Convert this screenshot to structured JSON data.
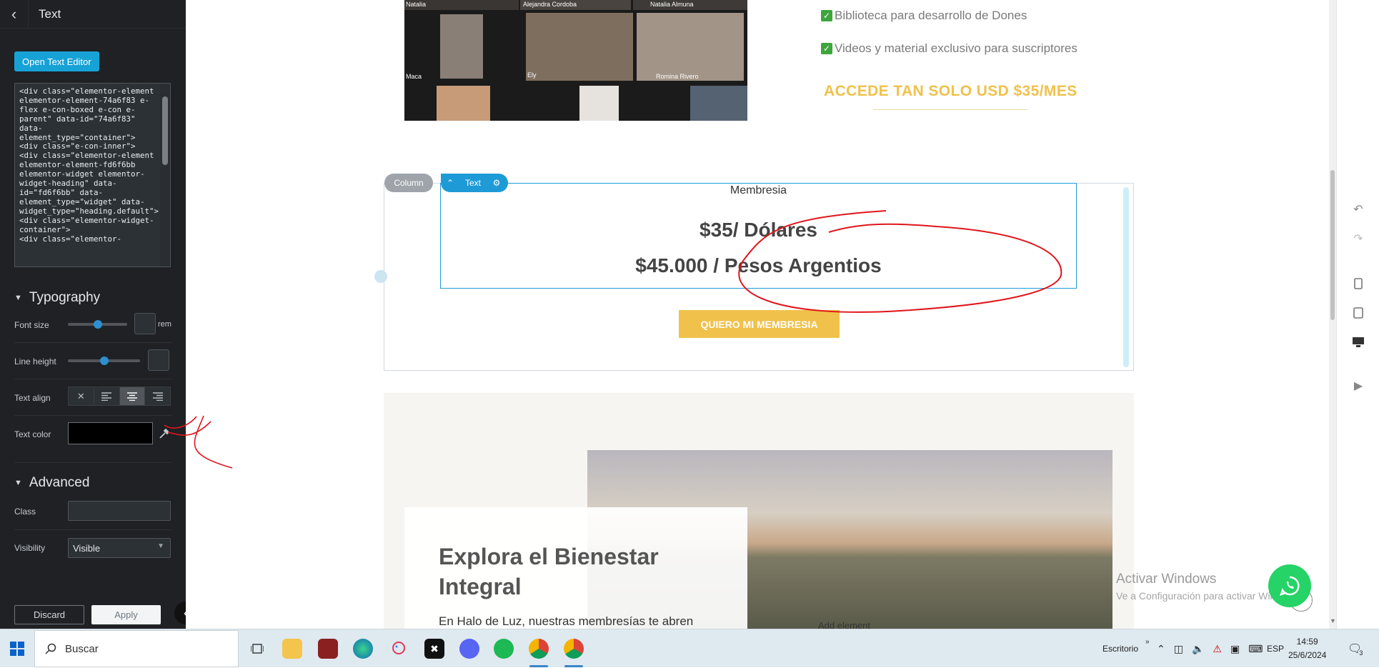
{
  "panel": {
    "title": "Text",
    "open_editor_label": "Open Text Editor",
    "code": "<div class=\"elementor-element elementor-element-74a6f83 e-flex e-con-boxed e-con e-parent\" data-id=\"74a6f83\" data-element_type=\"container\">\n<div class=\"e-con-inner\">\n<div class=\"elementor-element elementor-element-fd6f6bb elementor-widget elementor-widget-heading\" data-id=\"fd6f6bb\" data-element_type=\"widget\" data-widget_type=\"heading.default\">\n<div class=\"elementor-widget-container\">\n<div class=\"elementor-",
    "typography": {
      "title": "Typography",
      "font_size_label": "Font size",
      "font_size_unit": "rem",
      "font_size_level": 0.5,
      "line_height_label": "Line height",
      "line_height_level": 0.5,
      "text_align_label": "Text align",
      "text_align_options": [
        "none",
        "left",
        "center",
        "right"
      ],
      "text_align_selected": "center",
      "text_color_label": "Text color",
      "text_color_value": "#000000"
    },
    "advanced": {
      "title": "Advanced",
      "class_label": "Class",
      "class_value": "",
      "visibility_label": "Visibility",
      "visibility_value": "Visible"
    },
    "discard_label": "Discard",
    "apply_label": "Apply"
  },
  "canvas": {
    "video_names": [
      "Natalia",
      "Alejandra Cordoba",
      "Natalia Almuna",
      "Maca",
      "Ely",
      "Romina Rivero"
    ],
    "benefits": [
      "Biblioteca para desarrollo de Dones",
      "Videos y material exclusivo para suscriptores"
    ],
    "accede": "ACCEDE TAN SOLO USD $35/MES",
    "column_tag": "Column",
    "text_tag": "Text",
    "membresia": "Membresia",
    "price_usd": "$35/ Dólares",
    "price_ars": "$45.000 / Pesos Argentios",
    "cta": "QUIERO MI MEMBRESIA",
    "card_title": "Explora el Bienestar Integral",
    "card_text": "En Halo de Luz, nuestras membresías te abren",
    "add_element": "Add element",
    "watermark_title": "Activar Windows",
    "watermark_sub": "Ve a Configuración para activar Windows."
  },
  "taskbar": {
    "search_placeholder": "Buscar",
    "desktop_label": "Escritorio",
    "lang": "ESP",
    "time": "14:59",
    "date": "25/6/2024",
    "notif_count": "3"
  },
  "colors": {
    "panel_bg": "#1f2124",
    "accent_blue": "#1e9bd6",
    "gold": "#f0c14b",
    "annotation_red": "#e0151b",
    "whatsapp": "#25d366"
  }
}
